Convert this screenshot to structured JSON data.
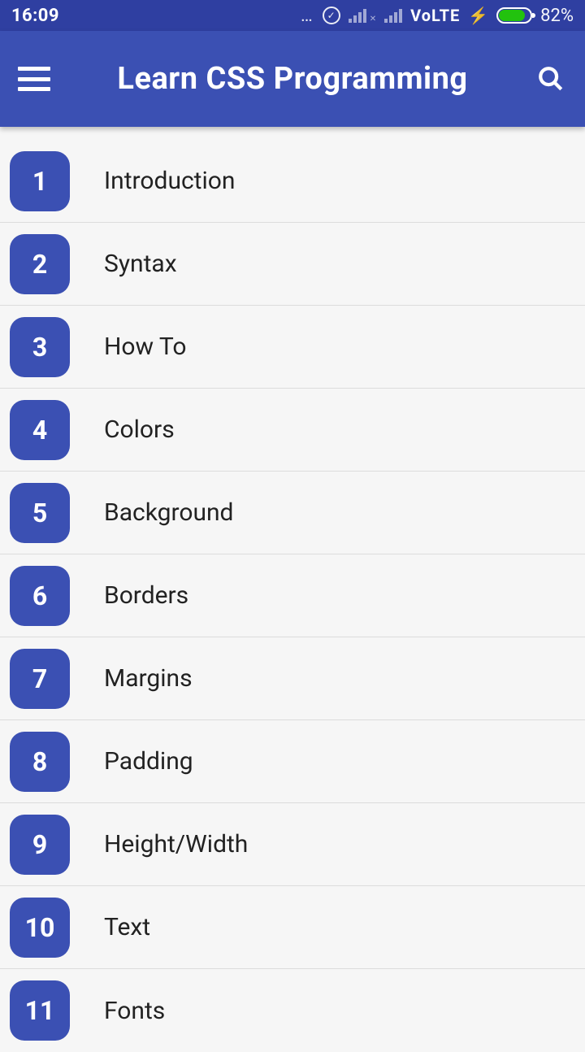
{
  "status": {
    "time": "16:09",
    "volte": "VoLTE",
    "battery_pct": "82%"
  },
  "header": {
    "title": "Learn CSS Programming"
  },
  "topics": [
    {
      "num": "1",
      "label": "Introduction"
    },
    {
      "num": "2",
      "label": "Syntax"
    },
    {
      "num": "3",
      "label": "How To"
    },
    {
      "num": "4",
      "label": "Colors"
    },
    {
      "num": "5",
      "label": "Background"
    },
    {
      "num": "6",
      "label": "Borders"
    },
    {
      "num": "7",
      "label": "Margins"
    },
    {
      "num": "8",
      "label": "Padding"
    },
    {
      "num": "9",
      "label": "Height/Width"
    },
    {
      "num": "10",
      "label": "Text"
    },
    {
      "num": "11",
      "label": "Fonts"
    }
  ]
}
